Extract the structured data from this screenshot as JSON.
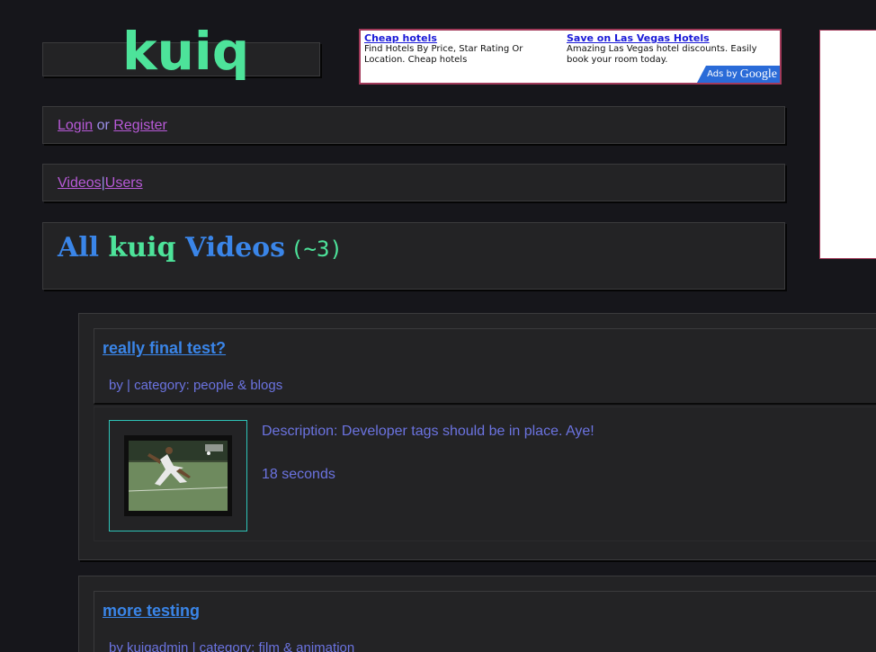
{
  "site": {
    "logo": "kuiq"
  },
  "ad": {
    "items": [
      {
        "title": "Cheap hotels",
        "desc": "Find Hotels By Price, Star Rating Or Location. Cheap hotels"
      },
      {
        "title": "Save on Las Vegas Hotels",
        "desc": "Amazing Las Vegas hotel discounts. Easily book your room today."
      }
    ],
    "ads_by": "Ads by",
    "ads_brand": "Google"
  },
  "auth": {
    "login": "Login",
    "or": "or",
    "register": "Register"
  },
  "nav": {
    "videos": "Videos",
    "sep": "|",
    "users": "Users"
  },
  "page": {
    "title_pre": "All ",
    "title_mid": "kuiq",
    "title_post": " Videos",
    "count": "(~3)"
  },
  "videos": [
    {
      "title": "really final test?",
      "meta_by": "by",
      "meta_user": "",
      "meta_cat_label": "| category:",
      "meta_cat": "people & blogs",
      "description": "Description: Developer tags should be in place. Aye!",
      "duration": "18 seconds"
    },
    {
      "title": "more testing",
      "meta_by": "by",
      "meta_user": "kuiqadmin",
      "meta_cat_label": "| category:",
      "meta_cat": "film & animation"
    }
  ],
  "colors": {
    "background": "#16161b",
    "panel": "#232325",
    "accent_green": "#4de39a",
    "accent_blue": "#3a85e8",
    "link_purple": "#b85ad8"
  }
}
